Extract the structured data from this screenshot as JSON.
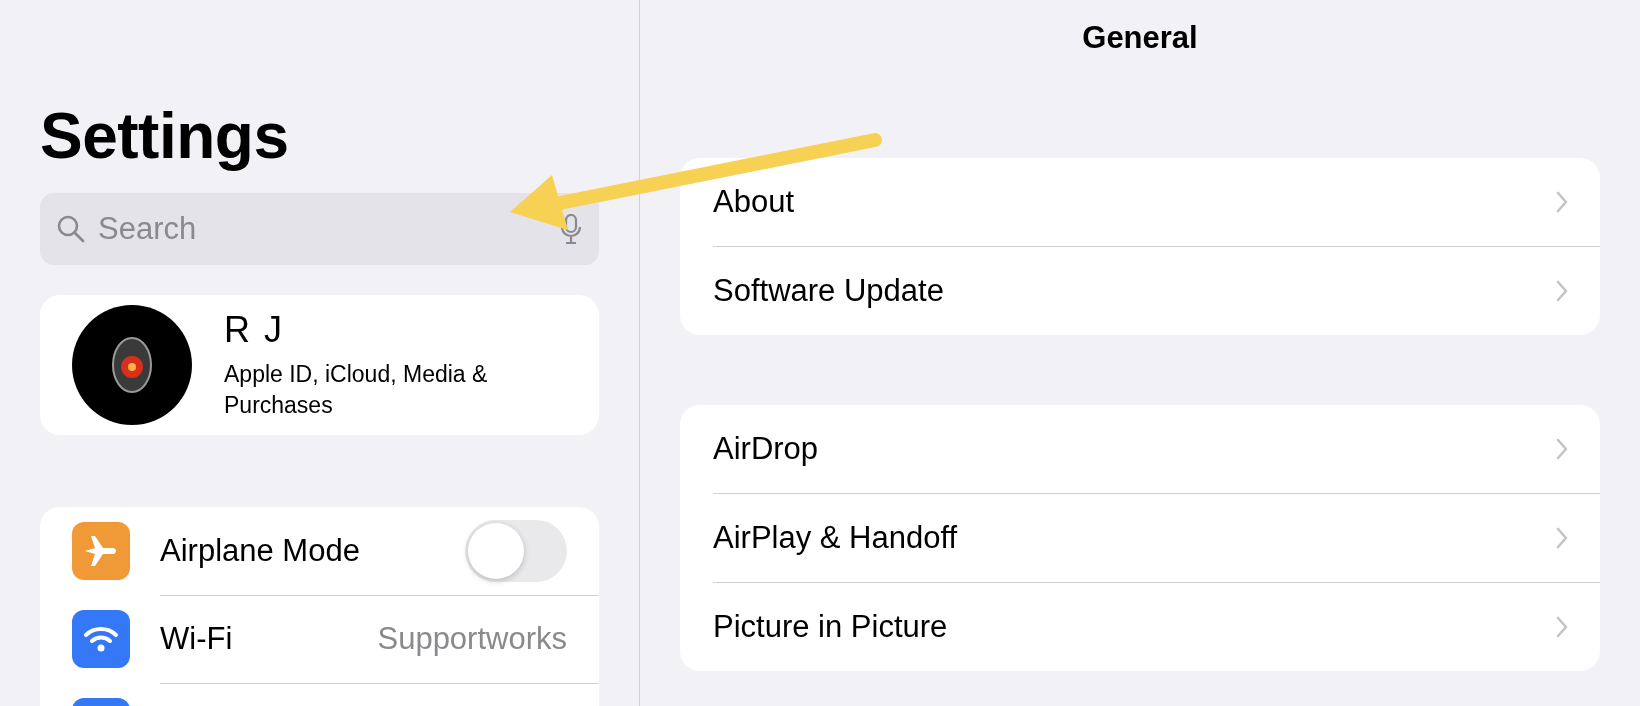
{
  "sidebar": {
    "title": "Settings",
    "search": {
      "placeholder": "Search"
    },
    "profile": {
      "name": "R J",
      "subtitle": "Apple ID, iCloud, Media & Purchases"
    },
    "items": [
      {
        "kind": "toggle",
        "color": "#f09a37",
        "label": "Airplane Mode",
        "on": false
      },
      {
        "kind": "value",
        "color": "#3478f6",
        "label": "Wi-Fi",
        "value": "Supportworks"
      },
      {
        "kind": "clipped",
        "color": "#3478f6"
      }
    ]
  },
  "detail": {
    "title": "General",
    "groups": [
      {
        "rows": [
          {
            "label": "About"
          },
          {
            "label": "Software Update"
          }
        ]
      },
      {
        "rows": [
          {
            "label": "AirDrop"
          },
          {
            "label": "AirPlay & Handoff"
          },
          {
            "label": "Picture in Picture"
          }
        ]
      }
    ]
  }
}
